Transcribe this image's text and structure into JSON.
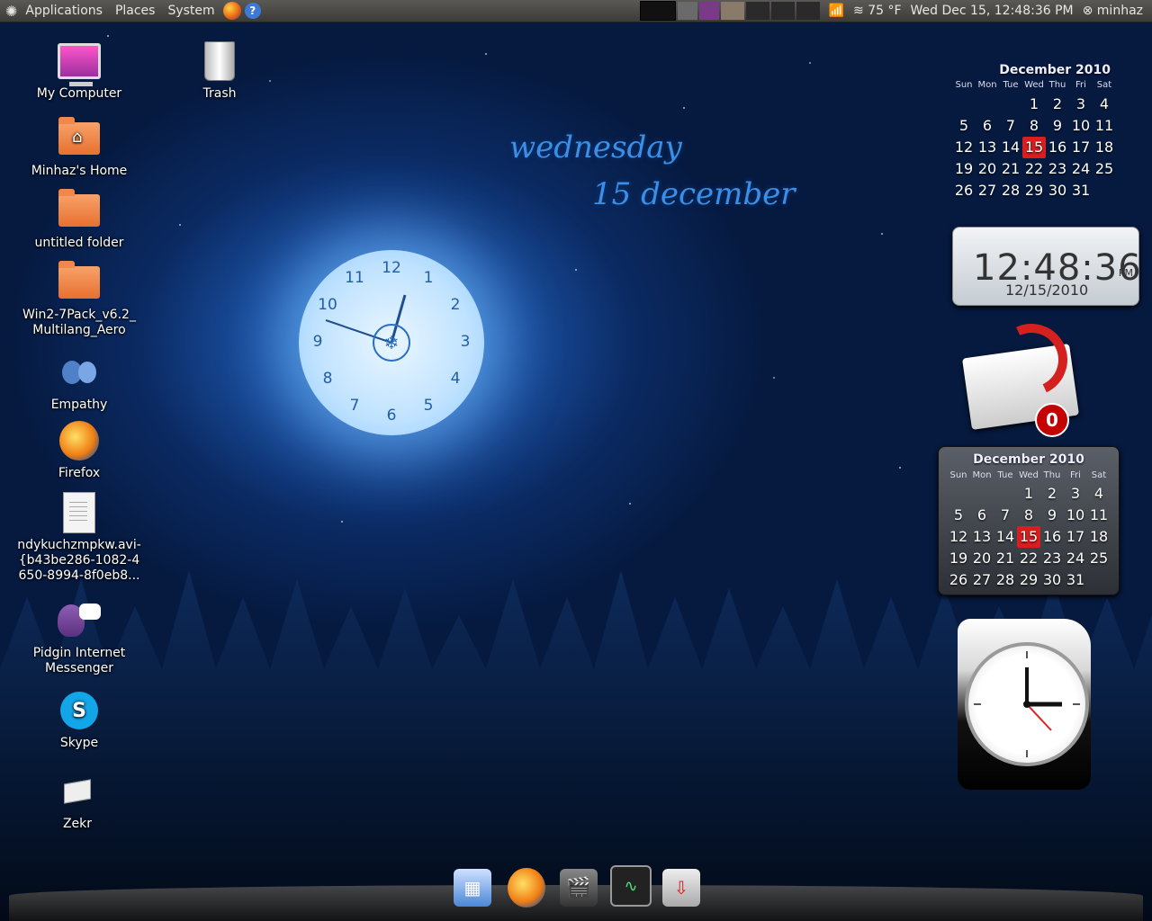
{
  "top_panel": {
    "menus": [
      "Applications",
      "Places",
      "System"
    ],
    "weather": "75 °F",
    "datetime": "Wed Dec 15, 12:48:36 PM",
    "user": "minhaz"
  },
  "desktop_icons": [
    {
      "label": "My Computer",
      "icon": "computer-icon"
    },
    {
      "label": "Trash",
      "icon": "trash-icon"
    },
    {
      "label": "Minhaz's Home",
      "icon": "home-folder-icon"
    },
    {
      "label": "untitled folder",
      "icon": "folder-icon"
    },
    {
      "label": "Win2-7Pack_v6.2_ Multilang_Aero",
      "icon": "folder-icon"
    },
    {
      "label": "Empathy",
      "icon": "empathy-icon"
    },
    {
      "label": "Firefox",
      "icon": "firefox-icon"
    },
    {
      "label": "ndykuchzmpkw.avi-{b43be286-1082-4650-8994-8f0eb8...",
      "icon": "document-icon"
    },
    {
      "label": "Pidgin Internet Messenger",
      "icon": "pidgin-icon"
    },
    {
      "label": "Skype",
      "icon": "skype-icon"
    },
    {
      "label": "Zekr",
      "icon": "zekr-icon"
    }
  ],
  "wallpaper_text": {
    "day": "wednesday",
    "date": "15 december"
  },
  "moon_clock": {
    "numbers": [
      "12",
      "1",
      "2",
      "3",
      "4",
      "5",
      "6",
      "7",
      "8",
      "9",
      "10",
      "11"
    ]
  },
  "calendar_top": {
    "title": "December 2010",
    "weekdays": [
      "Sun",
      "Mon",
      "Tue",
      "Wed",
      "Thu",
      "Fri",
      "Sat"
    ],
    "cells": [
      "",
      "",
      "",
      "1",
      "2",
      "3",
      "4",
      "5",
      "6",
      "7",
      "8",
      "9",
      "10",
      "11",
      "12",
      "13",
      "14",
      "15",
      "16",
      "17",
      "18",
      "19",
      "20",
      "21",
      "22",
      "23",
      "24",
      "25",
      "26",
      "27",
      "28",
      "29",
      "30",
      "31",
      ""
    ],
    "today": "15"
  },
  "digital_clock": {
    "time": "12:48:36",
    "ampm": "PM",
    "date": "12/15/2010"
  },
  "mail_widget": {
    "unread": "0"
  },
  "calendar_bottom": {
    "title": "December 2010",
    "weekdays": [
      "Sun",
      "Mon",
      "Tue",
      "Wed",
      "Thu",
      "Fri",
      "Sat"
    ],
    "cells": [
      "",
      "",
      "",
      "1",
      "2",
      "3",
      "4",
      "5",
      "6",
      "7",
      "8",
      "9",
      "10",
      "11",
      "12",
      "13",
      "14",
      "15",
      "16",
      "17",
      "18",
      "19",
      "20",
      "21",
      "22",
      "23",
      "24",
      "25",
      "26",
      "27",
      "28",
      "29",
      "30",
      "31",
      ""
    ],
    "today": "15"
  },
  "dock": {
    "items": [
      "desktop-switcher-icon",
      "firefox-icon",
      "video-editor-icon",
      "system-monitor-icon",
      "usb-installer-icon"
    ]
  },
  "colors": {
    "today_highlight": "#d81e1e",
    "wallpaper_text": "#3b8fe6"
  }
}
